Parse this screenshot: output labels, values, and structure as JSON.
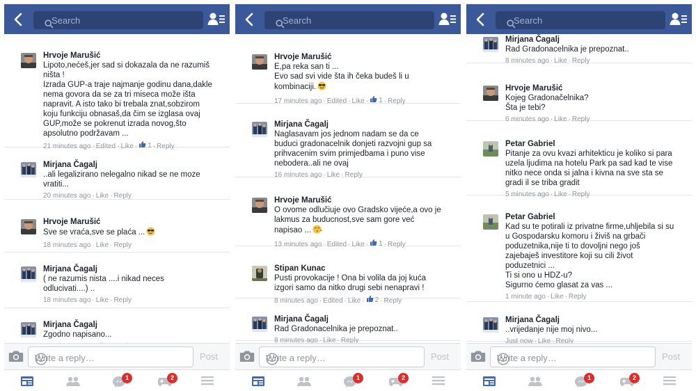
{
  "colors": {
    "topbar": "#3b5998",
    "author": "#1d2129",
    "meta": "#90949c",
    "like_blue": "#4267b2",
    "badge": "#e02b2b"
  },
  "search": {
    "placeholder": "Search"
  },
  "reply": {
    "placeholder": "Write a reply…",
    "post_label": "Post"
  },
  "tabs": [
    {
      "name": "news-feed-icon",
      "badge": ""
    },
    {
      "name": "friend-requests-icon",
      "badge": ""
    },
    {
      "name": "messages-icon",
      "badge": "1"
    },
    {
      "name": "notifications-icon",
      "badge": "2"
    },
    {
      "name": "menu-icon",
      "badge": ""
    }
  ],
  "screens": [
    {
      "comments": [
        {
          "author": "Hrvoje Marušić",
          "avatar": "hrvoje",
          "text": "Lipoto,nećeš,jer sad si dokazala da ne razumiš\nništa !\nIzrada GUP-a traje najmanje godinu dana,dakle\nnema govora da se za tri miseca može išta\nnapravit. A isto tako bi trebala znat,sobzirom\nkoju funkciju obnasaš,da čim se izglasa ovaj\nGUP,može se pokrenut izrada novog,što\napsolutno podržavam ...",
          "time": "21 minutes ago",
          "edited": true,
          "like": "Like",
          "likes": "1",
          "reply": "Reply",
          "emoji": ""
        },
        {
          "author": "Mirjana Čagalj",
          "avatar": "mirjana",
          "text": "..ali legalizirano nelegalno nikad se ne moze\nvratiti...",
          "time": "20 minutes ago",
          "edited": false,
          "like": "Like",
          "likes": "",
          "reply": "Reply",
          "emoji": ""
        },
        {
          "author": "Hrvoje Marušić",
          "avatar": "hrvoje",
          "text": "Sve se vraća,sve se plaća ...",
          "time": "18 minutes ago",
          "edited": false,
          "like": "Like",
          "likes": "",
          "reply": "Reply",
          "emoji": "sunglasses"
        },
        {
          "author": "Mirjana Čagalj",
          "avatar": "mirjana",
          "text": "( ne razumis nista ....i nikad neces\nodlucivati....) ..",
          "time": "18 minutes ago",
          "edited": false,
          "like": "Like",
          "likes": "",
          "reply": "Reply",
          "emoji": ""
        },
        {
          "author": "Mirjana Čagalj",
          "avatar": "mirjana",
          "text": "Zgodno napisano...",
          "time": "18 minutes ago",
          "edited": false,
          "like": "Like",
          "likes": "",
          "reply": "Reply",
          "emoji": ""
        }
      ]
    },
    {
      "comments": [
        {
          "author": "Hrvoje Marušić",
          "avatar": "hrvoje",
          "text": "E,pa reka san ti ...\nEvo sad svi vide šta ih čeka budeš li u\nkombinaciji.",
          "time": "17 minutes ago",
          "edited": true,
          "like": "Like",
          "likes": "1",
          "reply": "Reply",
          "emoji": "sunglasses"
        },
        {
          "author": "Mirjana Čagalj",
          "avatar": "mirjana",
          "text": "Naglasavam jos jednom nadam se  da ce\nbuduci gradonacelnik donjeti razvojni gup sa\nprihvacenim svim primjedbama i puno vise\nnebodera..ali ne ovaj",
          "time": "16 minutes ago",
          "edited": false,
          "like": "Like",
          "likes": "",
          "reply": "Reply",
          "emoji": ""
        },
        {
          "author": "Hrvoje Marušić",
          "avatar": "hrvoje",
          "text": "O ovome odlučiuje ovo Gradsko vijeće,a ovo je\nlakmus za buducnost,sve sam gore već\nnapisao ...",
          "time": "13 minutes ago",
          "edited": true,
          "like": "Like",
          "likes": "1",
          "reply": "Reply",
          "emoji": "kiss"
        },
        {
          "author": "Stipan Kunac",
          "avatar": "stipan",
          "text": "Pusti provokacije ! Ona bi volila da  joj  kuća\nizgori samo da nitko drugi sebi nenapravi !",
          "time": "8 minutes ago",
          "edited": true,
          "like": "Like",
          "likes": "2",
          "reply": "Reply",
          "emoji": ""
        },
        {
          "author": "Mirjana Čagalj",
          "avatar": "mirjana",
          "text": "Rad Gradonacelnika  je prepoznat..",
          "time": "8 minutes ago",
          "edited": false,
          "like": "Like",
          "likes": "",
          "reply": "Reply",
          "emoji": ""
        }
      ]
    },
    {
      "comments": [
        {
          "author": "Mirjana Čagalj",
          "avatar": "mirjana",
          "text": "Rad Gradonacelnika  je prepoznat..",
          "time": "8 minutes ago",
          "edited": false,
          "like": "Like",
          "likes": "",
          "reply": "Reply",
          "emoji": ""
        },
        {
          "author": "Hrvoje Marušić",
          "avatar": "hrvoje",
          "text": "Kojeg Gradonačelnika?\nŠta je tebi?",
          "time": "6 minutes ago",
          "edited": false,
          "like": "Like",
          "likes": "",
          "reply": "Reply",
          "emoji": ""
        },
        {
          "author": "Petar Gabriel",
          "avatar": "petar",
          "text": "Pitanje za ovu kvazi arhitekticu je koliko si para\nuzela ljudima na hotelu Park pa sad kad te vise\nnitko nece onda si jalna i kivna na sve sta se\ngradi il se triba gradit",
          "time": "5 minutes ago",
          "edited": false,
          "like": "Like",
          "likes": "",
          "reply": "Reply",
          "emoji": ""
        },
        {
          "author": "Petar Gabriel",
          "avatar": "petar",
          "text": "Kad su te potirali iz privatne firme,uhljebila si su\nu Gospodarsku komoru i živiš na grbači\npoduzetnika,nije ti to dovoljni nego još\nzajebaješ investitore koji su cili život\npoduzetnici ...\nTi si ono u HDZ-u?\nSigurno ćemo glasat za vas ...",
          "time": "1 minute ago",
          "edited": false,
          "like": "Like",
          "likes": "",
          "reply": "Reply",
          "emoji": ""
        },
        {
          "author": "Mirjana Čagalj",
          "avatar": "mirjana",
          "text": "..vrijedanje nije moj nivo...",
          "time": "Just now",
          "edited": false,
          "like": "Like",
          "likes": "",
          "reply": "Reply",
          "emoji": ""
        }
      ]
    }
  ]
}
